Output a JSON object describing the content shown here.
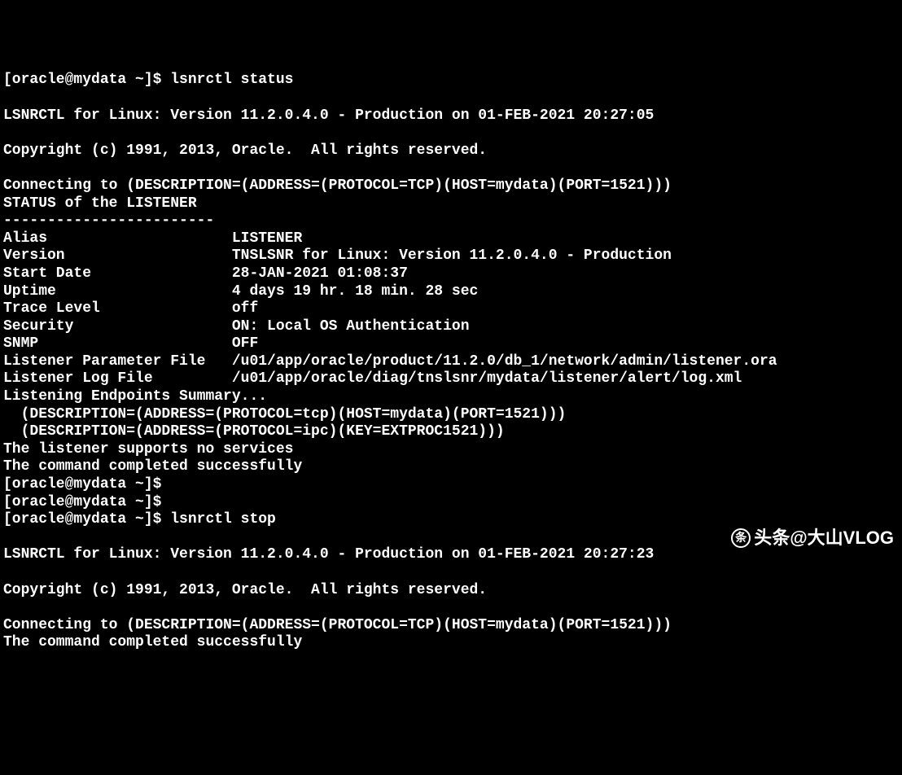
{
  "terminal": {
    "prompt": "[oracle@mydata ~]$ ",
    "cmd1": "lsnrctl status",
    "cmd2": "lsnrctl stop",
    "blank": "",
    "version_line1": "LSNRCTL for Linux: Version 11.2.0.4.0 - Production on 01-FEB-2021 20:27:05",
    "copyright": "Copyright (c) 1991, 2013, Oracle.  All rights reserved.",
    "connecting": "Connecting to (DESCRIPTION=(ADDRESS=(PROTOCOL=TCP)(HOST=mydata)(PORT=1521)))",
    "status_header": "STATUS of the LISTENER",
    "separator": "------------------------",
    "alias_label": "Alias                     LISTENER",
    "version_label": "Version                   TNSLSNR for Linux: Version 11.2.0.4.0 - Production",
    "startdate_label": "Start Date                28-JAN-2021 01:08:37",
    "uptime_label": "Uptime                    4 days 19 hr. 18 min. 28 sec",
    "trace_label": "Trace Level               off",
    "security_label": "Security                  ON: Local OS Authentication",
    "snmp_label": "SNMP                      OFF",
    "param_file": "Listener Parameter File   /u01/app/oracle/product/11.2.0/db_1/network/admin/listener.ora",
    "log_file": "Listener Log File         /u01/app/oracle/diag/tnslsnr/mydata/listener/alert/log.xml",
    "endpoints_summary": "Listening Endpoints Summary...",
    "endpoint1": "  (DESCRIPTION=(ADDRESS=(PROTOCOL=tcp)(HOST=mydata)(PORT=1521)))",
    "endpoint2": "  (DESCRIPTION=(ADDRESS=(PROTOCOL=ipc)(KEY=EXTPROC1521)))",
    "no_services": "The listener supports no services",
    "completed": "The command completed successfully",
    "version_line2": "LSNRCTL for Linux: Version 11.2.0.4.0 - Production on 01-FEB-2021 20:27:23",
    "connecting2": "Connecting to (DESCRIPTION=(ADDRESS=(PROTOCOL=TCP)(HOST=mydata)(PORT=1521)))"
  },
  "watermark": {
    "text": "头条@大山VLOG"
  }
}
